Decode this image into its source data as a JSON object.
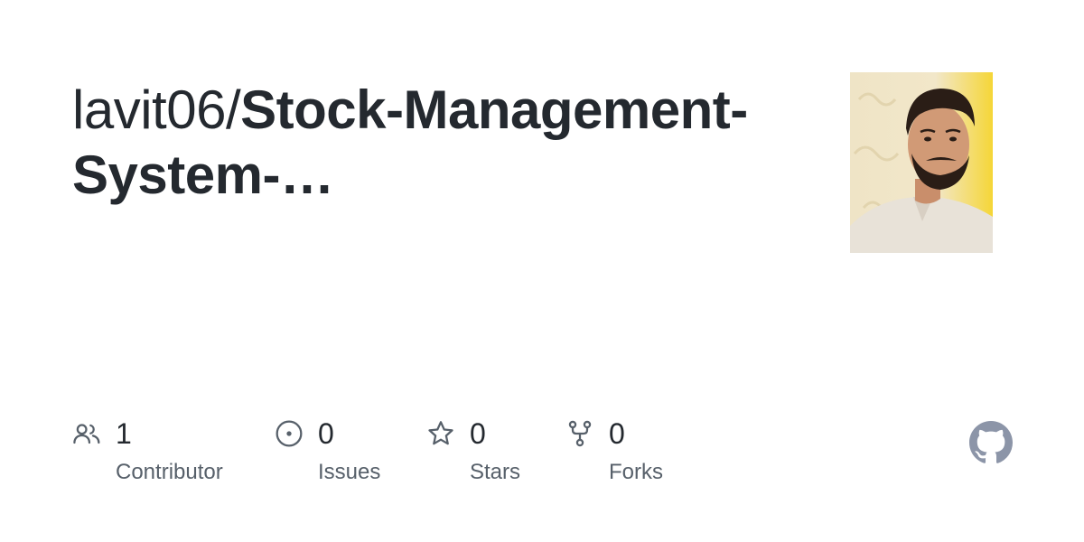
{
  "repo_card": {
    "owner": "lavit06/",
    "repo_name": "Stock-Management-System-…"
  },
  "stats": [
    {
      "icon": "people-icon",
      "count": "1",
      "label": "Contributor"
    },
    {
      "icon": "issue-opened-icon",
      "count": "0",
      "label": "Issues"
    },
    {
      "icon": "star-icon",
      "count": "0",
      "label": "Stars"
    },
    {
      "icon": "repo-forked-icon",
      "count": "0",
      "label": "Forks"
    }
  ],
  "colors": {
    "text_primary": "#24292f",
    "text_secondary": "#57606a",
    "icon": "#57606a",
    "logo": "#8c95a8"
  },
  "logo": {
    "icon": "github-mark-icon"
  }
}
